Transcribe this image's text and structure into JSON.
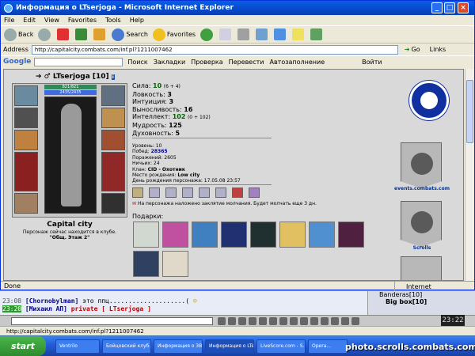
{
  "window": {
    "title": "Информация о LTserjoga - Microsoft Internet Explorer"
  },
  "menu": [
    "File",
    "Edit",
    "View",
    "Favorites",
    "Tools",
    "Help"
  ],
  "toolbar": {
    "back": "Back",
    "search": "Search",
    "favorites": "Favorites"
  },
  "address": {
    "label": "Address",
    "url": "http://capitalcity.combats.com/inf.pl?1211007462",
    "go": "Go",
    "links": "Links"
  },
  "google": {
    "logo": "Google",
    "search": "Поиск",
    "bookmarks": "Закладки",
    "check": "Проверка",
    "translate": "Перевести",
    "autofill": "Автозаполнение",
    "login": "Войти"
  },
  "character": {
    "name": "LTserjoga [10]",
    "hp": "821/821",
    "mp": "2435/2435",
    "city": "Capital city",
    "location_text": "Персонаж сейчас находится в клубе.",
    "location_place": "\"Общ. Этаж 2\""
  },
  "stats": [
    {
      "label": "Сила:",
      "value": "10",
      "extra": "(6 + 4)"
    },
    {
      "label": "Ловкость:",
      "value": "3",
      "extra": ""
    },
    {
      "label": "Интуиция:",
      "value": "3",
      "extra": ""
    },
    {
      "label": "Выносливость:",
      "value": "16",
      "extra": ""
    },
    {
      "label": "Интеллект:",
      "value": "102",
      "extra": "(0 + 102)"
    },
    {
      "label": "Мудрость:",
      "value": "125",
      "extra": ""
    },
    {
      "label": "Духовность:",
      "value": "5",
      "extra": ""
    }
  ],
  "info": {
    "level": "Уровень: 10",
    "wins_label": "Побед:",
    "wins": "28365",
    "losses": "Поражений: 2605",
    "draws": "Ничьих: 24",
    "clan_label": "Клан:",
    "clan": "CID - Охотник",
    "birthplace_label": "Место рождения:",
    "birthplace": "Low city",
    "birthday": "День рождения персонажа: 17.05.08 23:57"
  },
  "spell_text": "На персонажа наложено заклятие молчания. Будет молчать еще 3 дн.",
  "gifts_label": "Подарки:",
  "side": {
    "events": "events.combats.com",
    "scrolls": "Scrolls"
  },
  "status": {
    "text": "Done",
    "zone": "Internet"
  },
  "chat": [
    {
      "time": "23:08",
      "name": "[Chornobylman]",
      "text": " это ппц....................(",
      "priv": ""
    },
    {
      "time": "23:20",
      "name": "[Михаил АП]",
      "text": " ",
      "priv": "private [ LTserjoga ]"
    }
  ],
  "rightlist": [
    "Banderas[10]",
    "Big box[10]"
  ],
  "clock": "23:22",
  "bottom_url": "http://capitalcity.combats.com/inf.pl?1211007462",
  "taskbar": {
    "start": "start",
    "tasks": [
      "Ventrilo",
      "Бойцовский клуб...",
      "Информация о 3В...",
      "Информация о LTs...",
      "LiveScore.com - S...",
      "Opera..."
    ]
  },
  "watermark": "photo.scrolls.combats.com",
  "colors": {
    "titlebar": "#0649c9",
    "content_bg": "#d9d9d9",
    "stat_value": "#006400",
    "chat_private": "#c00000"
  }
}
